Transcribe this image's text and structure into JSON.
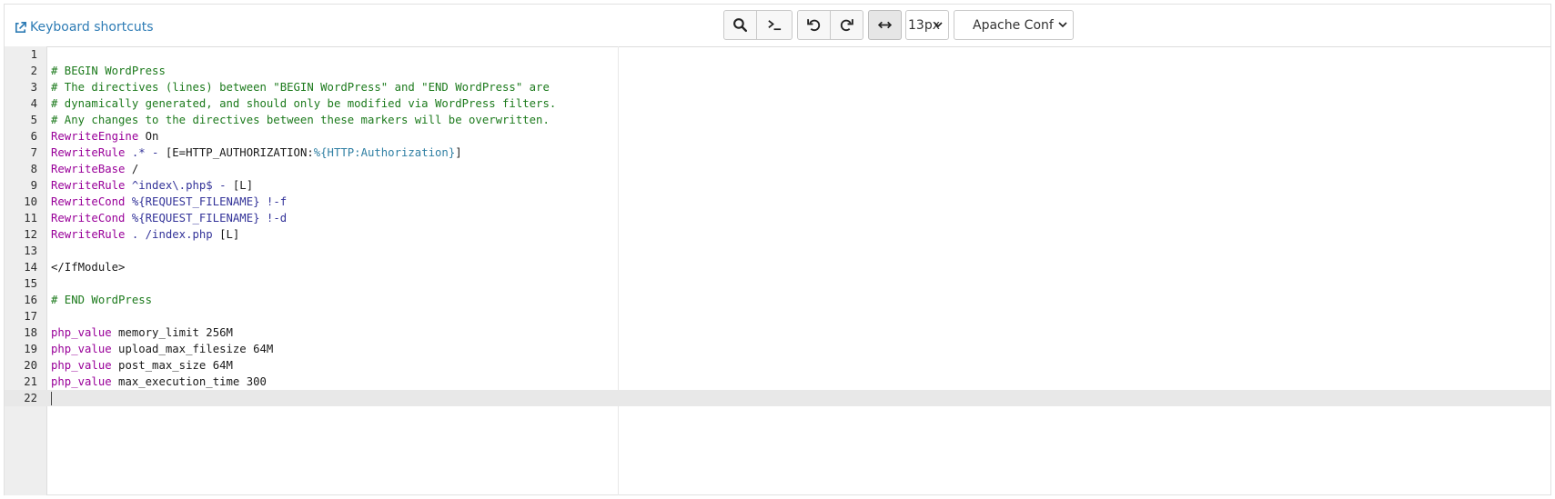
{
  "toolbar": {
    "keyboard_shortcuts_label": "Keyboard shortcuts",
    "font_size_label": "13px",
    "mode_label": "Apache Conf",
    "icons": [
      "external-link-icon",
      "search-icon",
      "terminal-icon",
      "undo-icon",
      "redo-icon",
      "wrap-toggle-icon",
      "chevron-down-icon"
    ]
  },
  "editor": {
    "active_line": 22,
    "lines": [
      {
        "n": "1",
        "tokens": []
      },
      {
        "n": "2",
        "tokens": [
          {
            "t": "comment",
            "v": "# BEGIN WordPress"
          }
        ]
      },
      {
        "n": "3",
        "tokens": [
          {
            "t": "comment",
            "v": "# The directives (lines) between \"BEGIN WordPress\" and \"END WordPress\" are"
          }
        ]
      },
      {
        "n": "4",
        "tokens": [
          {
            "t": "comment",
            "v": "# dynamically generated, and should only be modified via WordPress filters."
          }
        ]
      },
      {
        "n": "5",
        "tokens": [
          {
            "t": "comment",
            "v": "# Any changes to the directives between these markers will be overwritten."
          }
        ]
      },
      {
        "n": "6",
        "tokens": [
          {
            "t": "kw",
            "v": "RewriteEngine"
          },
          {
            "t": "plain",
            "v": " On"
          }
        ]
      },
      {
        "n": "7",
        "tokens": [
          {
            "t": "kw",
            "v": "RewriteRule"
          },
          {
            "t": "plain",
            "v": " "
          },
          {
            "t": "str",
            "v": ".* -"
          },
          {
            "t": "plain",
            "v": " [E=HTTP_AUTHORIZATION:"
          },
          {
            "t": "var",
            "v": "%{HTTP:Authorization}"
          },
          {
            "t": "plain",
            "v": "]"
          }
        ]
      },
      {
        "n": "8",
        "tokens": [
          {
            "t": "kw",
            "v": "RewriteBase"
          },
          {
            "t": "plain",
            "v": " /"
          }
        ]
      },
      {
        "n": "9",
        "tokens": [
          {
            "t": "kw",
            "v": "RewriteRule"
          },
          {
            "t": "plain",
            "v": " "
          },
          {
            "t": "str",
            "v": "^index\\.php$ -"
          },
          {
            "t": "plain",
            "v": " [L]"
          }
        ]
      },
      {
        "n": "10",
        "tokens": [
          {
            "t": "kw",
            "v": "RewriteCond"
          },
          {
            "t": "plain",
            "v": " "
          },
          {
            "t": "str",
            "v": "%{REQUEST_FILENAME} !-f"
          }
        ]
      },
      {
        "n": "11",
        "tokens": [
          {
            "t": "kw",
            "v": "RewriteCond"
          },
          {
            "t": "plain",
            "v": " "
          },
          {
            "t": "str",
            "v": "%{REQUEST_FILENAME} !-d"
          }
        ]
      },
      {
        "n": "12",
        "tokens": [
          {
            "t": "kw",
            "v": "RewriteRule"
          },
          {
            "t": "plain",
            "v": " "
          },
          {
            "t": "str",
            "v": ". /index.php"
          },
          {
            "t": "plain",
            "v": " [L]"
          }
        ]
      },
      {
        "n": "13",
        "tokens": []
      },
      {
        "n": "14",
        "tokens": [
          {
            "t": "plain",
            "v": "</IfModule>"
          }
        ]
      },
      {
        "n": "15",
        "tokens": []
      },
      {
        "n": "16",
        "tokens": [
          {
            "t": "comment",
            "v": "# END WordPress"
          }
        ]
      },
      {
        "n": "17",
        "tokens": []
      },
      {
        "n": "18",
        "tokens": [
          {
            "t": "kw",
            "v": "php_value"
          },
          {
            "t": "plain",
            "v": " memory_limit 256M"
          }
        ]
      },
      {
        "n": "19",
        "tokens": [
          {
            "t": "kw",
            "v": "php_value"
          },
          {
            "t": "plain",
            "v": " upload_max_filesize 64M"
          }
        ]
      },
      {
        "n": "20",
        "tokens": [
          {
            "t": "kw",
            "v": "php_value"
          },
          {
            "t": "plain",
            "v": " post_max_size 64M"
          }
        ]
      },
      {
        "n": "21",
        "tokens": [
          {
            "t": "kw",
            "v": "php_value"
          },
          {
            "t": "plain",
            "v": " max_execution_time 300"
          }
        ]
      },
      {
        "n": "22",
        "tokens": []
      }
    ]
  }
}
